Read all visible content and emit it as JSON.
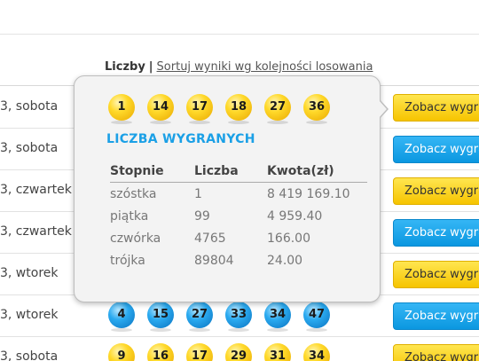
{
  "header": {
    "label": "Liczby",
    "separator": "|",
    "sort_link": "Sortuj wyniki wg kolejności losowania"
  },
  "rows": [
    {
      "date": "3, sobota",
      "button": "Zobacz wygrane",
      "button_color": "yellow"
    },
    {
      "date": "3, sobota",
      "button": "Zobacz wygrane",
      "button_color": "blue"
    },
    {
      "date": "3, czwartek",
      "button": "Zobacz wygrane",
      "button_color": "yellow"
    },
    {
      "date": "3, czwartek",
      "button": "Zobacz wygrane",
      "button_color": "blue"
    },
    {
      "date": "3, wtorek",
      "button": "Zobacz wygrane",
      "button_color": "yellow"
    },
    {
      "date": "3, wtorek",
      "button": "Zobacz wygrane",
      "button_color": "blue",
      "balls": [
        "4",
        "15",
        "27",
        "33",
        "34",
        "47"
      ],
      "ball_color": "blue"
    },
    {
      "date": "3, sobota",
      "button": "Zobacz wygrane",
      "button_color": "yellow",
      "balls": [
        "9",
        "16",
        "17",
        "29",
        "31",
        "34"
      ],
      "ball_color": "yellow"
    }
  ],
  "popup": {
    "balls": [
      "1",
      "14",
      "17",
      "18",
      "27",
      "36"
    ],
    "ball_color": "yellow",
    "title": "LICZBA WYGRANYCH",
    "columns": [
      "Stopnie",
      "Liczba",
      "Kwota(zł)"
    ],
    "prizes": [
      [
        "szóstka",
        "1",
        "8 419 169.10"
      ],
      [
        "piątka",
        "99",
        "4 959.40"
      ],
      [
        "czwórka",
        "4765",
        "166.00"
      ],
      [
        "trójka",
        "89804",
        "24.00"
      ]
    ]
  },
  "colors": {
    "yellow_button": "#f6c400",
    "blue_button": "#0b97e0",
    "title_blue": "#1ba0e6",
    "popup_bg": "#f3f3f3"
  },
  "icons": {
    "popup_arrow": "arrow-right-pointer"
  }
}
